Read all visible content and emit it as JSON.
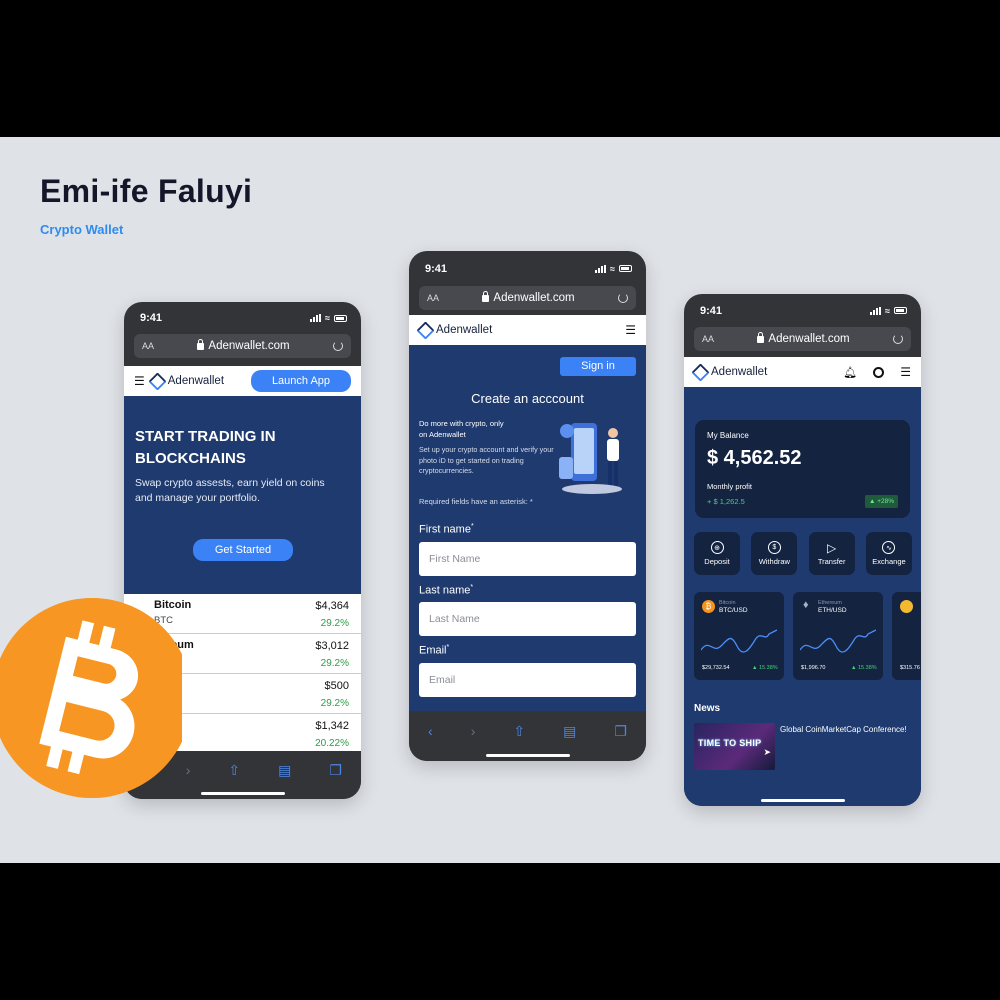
{
  "header": {
    "title": "Emi-ife Faluyi",
    "subtitle": "Crypto Wallet"
  },
  "device": {
    "time": "9:41",
    "text_size": "AA",
    "url": "Adenwallet.com"
  },
  "brand": {
    "name": "Adenwallet"
  },
  "landing": {
    "launch_label": "Launch App",
    "hero_title": "START TRADING IN BLOCKCHAINS",
    "hero_text": "Swap crypto assests, earn yield on coins and manage your portfolio.",
    "cta_label": "Get Started",
    "coins": [
      {
        "name": "Bitcoin",
        "symbol": "BTC",
        "price": "$4,364",
        "change": "29.2%"
      },
      {
        "name": "hereum",
        "symbol": "ereum",
        "price": "$3,012",
        "change": "29.2%"
      },
      {
        "name": "",
        "symbol": "",
        "price": "$500",
        "change": "29.2%"
      },
      {
        "name": "",
        "symbol": "",
        "price": "$1,342",
        "change": "20.22%"
      }
    ]
  },
  "signup": {
    "signin_label": "Sign in",
    "title": "Create an acccount",
    "lead": "Do more with crypto, only on Adenwallet",
    "desc": "Set up your crypto account and verify your photo iD to get started on trading cryptocurrencies.",
    "required_note": "Required fields have an asterisk: *",
    "first_label": "First name",
    "first_placeholder": "First Name",
    "last_label": "Last name",
    "last_placeholder": "Last Name",
    "email_label": "Email",
    "email_placeholder": "Email"
  },
  "dashboard": {
    "balance_label": "My Balance",
    "balance": "$ 4,562.52",
    "profit_label": "Monthly profit",
    "profit": "+ $ 1,262.5",
    "profit_badge": "+28%",
    "actions": [
      "Deposit",
      "Withdraw",
      "Transfer",
      "Exchange"
    ],
    "markets": [
      {
        "name": "Bitcoin",
        "pair": "BTC/USD",
        "price": "$29,732.54",
        "change": "15.38%"
      },
      {
        "name": "Ethereum",
        "pair": "ETH/USD",
        "price": "$1,996.70",
        "change": "15.38%"
      },
      {
        "name": "",
        "pair": "",
        "price": "$315.76",
        "change": ""
      }
    ],
    "news_title": "News",
    "news_headline": "Global CoinMarketCap Conference!",
    "news_thumb": "TIME TO SHIP"
  },
  "colors": {
    "accent": "#3b82f6",
    "navy": "#1e3a6e",
    "bitcoin": "#f7931a",
    "positive": "#2e9a48"
  }
}
